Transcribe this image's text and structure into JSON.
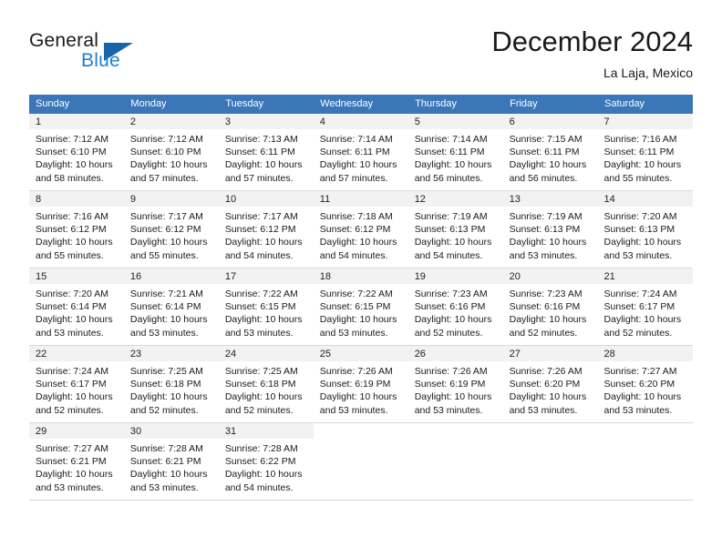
{
  "brand": {
    "name_part1": "General",
    "name_part2": "Blue",
    "triangle_color": "#1565a8",
    "blue_color": "#1f7fd0"
  },
  "header": {
    "title": "December 2024",
    "location": "La Laja, Mexico"
  },
  "theme": {
    "header_row_color": "#3A76B8",
    "daynum_band_color": "#f2f2f2",
    "grid_line_color": "#d9d9d9"
  },
  "weekdays": [
    "Sunday",
    "Monday",
    "Tuesday",
    "Wednesday",
    "Thursday",
    "Friday",
    "Saturday"
  ],
  "weeks": [
    [
      {
        "day": "1",
        "sunrise": "Sunrise: 7:12 AM",
        "sunset": "Sunset: 6:10 PM",
        "daylight_line1": "Daylight: 10 hours",
        "daylight_line2": "and 58 minutes."
      },
      {
        "day": "2",
        "sunrise": "Sunrise: 7:12 AM",
        "sunset": "Sunset: 6:10 PM",
        "daylight_line1": "Daylight: 10 hours",
        "daylight_line2": "and 57 minutes."
      },
      {
        "day": "3",
        "sunrise": "Sunrise: 7:13 AM",
        "sunset": "Sunset: 6:11 PM",
        "daylight_line1": "Daylight: 10 hours",
        "daylight_line2": "and 57 minutes."
      },
      {
        "day": "4",
        "sunrise": "Sunrise: 7:14 AM",
        "sunset": "Sunset: 6:11 PM",
        "daylight_line1": "Daylight: 10 hours",
        "daylight_line2": "and 57 minutes."
      },
      {
        "day": "5",
        "sunrise": "Sunrise: 7:14 AM",
        "sunset": "Sunset: 6:11 PM",
        "daylight_line1": "Daylight: 10 hours",
        "daylight_line2": "and 56 minutes."
      },
      {
        "day": "6",
        "sunrise": "Sunrise: 7:15 AM",
        "sunset": "Sunset: 6:11 PM",
        "daylight_line1": "Daylight: 10 hours",
        "daylight_line2": "and 56 minutes."
      },
      {
        "day": "7",
        "sunrise": "Sunrise: 7:16 AM",
        "sunset": "Sunset: 6:11 PM",
        "daylight_line1": "Daylight: 10 hours",
        "daylight_line2": "and 55 minutes."
      }
    ],
    [
      {
        "day": "8",
        "sunrise": "Sunrise: 7:16 AM",
        "sunset": "Sunset: 6:12 PM",
        "daylight_line1": "Daylight: 10 hours",
        "daylight_line2": "and 55 minutes."
      },
      {
        "day": "9",
        "sunrise": "Sunrise: 7:17 AM",
        "sunset": "Sunset: 6:12 PM",
        "daylight_line1": "Daylight: 10 hours",
        "daylight_line2": "and 55 minutes."
      },
      {
        "day": "10",
        "sunrise": "Sunrise: 7:17 AM",
        "sunset": "Sunset: 6:12 PM",
        "daylight_line1": "Daylight: 10 hours",
        "daylight_line2": "and 54 minutes."
      },
      {
        "day": "11",
        "sunrise": "Sunrise: 7:18 AM",
        "sunset": "Sunset: 6:12 PM",
        "daylight_line1": "Daylight: 10 hours",
        "daylight_line2": "and 54 minutes."
      },
      {
        "day": "12",
        "sunrise": "Sunrise: 7:19 AM",
        "sunset": "Sunset: 6:13 PM",
        "daylight_line1": "Daylight: 10 hours",
        "daylight_line2": "and 54 minutes."
      },
      {
        "day": "13",
        "sunrise": "Sunrise: 7:19 AM",
        "sunset": "Sunset: 6:13 PM",
        "daylight_line1": "Daylight: 10 hours",
        "daylight_line2": "and 53 minutes."
      },
      {
        "day": "14",
        "sunrise": "Sunrise: 7:20 AM",
        "sunset": "Sunset: 6:13 PM",
        "daylight_line1": "Daylight: 10 hours",
        "daylight_line2": "and 53 minutes."
      }
    ],
    [
      {
        "day": "15",
        "sunrise": "Sunrise: 7:20 AM",
        "sunset": "Sunset: 6:14 PM",
        "daylight_line1": "Daylight: 10 hours",
        "daylight_line2": "and 53 minutes."
      },
      {
        "day": "16",
        "sunrise": "Sunrise: 7:21 AM",
        "sunset": "Sunset: 6:14 PM",
        "daylight_line1": "Daylight: 10 hours",
        "daylight_line2": "and 53 minutes."
      },
      {
        "day": "17",
        "sunrise": "Sunrise: 7:22 AM",
        "sunset": "Sunset: 6:15 PM",
        "daylight_line1": "Daylight: 10 hours",
        "daylight_line2": "and 53 minutes."
      },
      {
        "day": "18",
        "sunrise": "Sunrise: 7:22 AM",
        "sunset": "Sunset: 6:15 PM",
        "daylight_line1": "Daylight: 10 hours",
        "daylight_line2": "and 53 minutes."
      },
      {
        "day": "19",
        "sunrise": "Sunrise: 7:23 AM",
        "sunset": "Sunset: 6:16 PM",
        "daylight_line1": "Daylight: 10 hours",
        "daylight_line2": "and 52 minutes."
      },
      {
        "day": "20",
        "sunrise": "Sunrise: 7:23 AM",
        "sunset": "Sunset: 6:16 PM",
        "daylight_line1": "Daylight: 10 hours",
        "daylight_line2": "and 52 minutes."
      },
      {
        "day": "21",
        "sunrise": "Sunrise: 7:24 AM",
        "sunset": "Sunset: 6:17 PM",
        "daylight_line1": "Daylight: 10 hours",
        "daylight_line2": "and 52 minutes."
      }
    ],
    [
      {
        "day": "22",
        "sunrise": "Sunrise: 7:24 AM",
        "sunset": "Sunset: 6:17 PM",
        "daylight_line1": "Daylight: 10 hours",
        "daylight_line2": "and 52 minutes."
      },
      {
        "day": "23",
        "sunrise": "Sunrise: 7:25 AM",
        "sunset": "Sunset: 6:18 PM",
        "daylight_line1": "Daylight: 10 hours",
        "daylight_line2": "and 52 minutes."
      },
      {
        "day": "24",
        "sunrise": "Sunrise: 7:25 AM",
        "sunset": "Sunset: 6:18 PM",
        "daylight_line1": "Daylight: 10 hours",
        "daylight_line2": "and 52 minutes."
      },
      {
        "day": "25",
        "sunrise": "Sunrise: 7:26 AM",
        "sunset": "Sunset: 6:19 PM",
        "daylight_line1": "Daylight: 10 hours",
        "daylight_line2": "and 53 minutes."
      },
      {
        "day": "26",
        "sunrise": "Sunrise: 7:26 AM",
        "sunset": "Sunset: 6:19 PM",
        "daylight_line1": "Daylight: 10 hours",
        "daylight_line2": "and 53 minutes."
      },
      {
        "day": "27",
        "sunrise": "Sunrise: 7:26 AM",
        "sunset": "Sunset: 6:20 PM",
        "daylight_line1": "Daylight: 10 hours",
        "daylight_line2": "and 53 minutes."
      },
      {
        "day": "28",
        "sunrise": "Sunrise: 7:27 AM",
        "sunset": "Sunset: 6:20 PM",
        "daylight_line1": "Daylight: 10 hours",
        "daylight_line2": "and 53 minutes."
      }
    ],
    [
      {
        "day": "29",
        "sunrise": "Sunrise: 7:27 AM",
        "sunset": "Sunset: 6:21 PM",
        "daylight_line1": "Daylight: 10 hours",
        "daylight_line2": "and 53 minutes."
      },
      {
        "day": "30",
        "sunrise": "Sunrise: 7:28 AM",
        "sunset": "Sunset: 6:21 PM",
        "daylight_line1": "Daylight: 10 hours",
        "daylight_line2": "and 53 minutes."
      },
      {
        "day": "31",
        "sunrise": "Sunrise: 7:28 AM",
        "sunset": "Sunset: 6:22 PM",
        "daylight_line1": "Daylight: 10 hours",
        "daylight_line2": "and 54 minutes."
      },
      {
        "day": "",
        "sunrise": "",
        "sunset": "",
        "daylight_line1": "",
        "daylight_line2": ""
      },
      {
        "day": "",
        "sunrise": "",
        "sunset": "",
        "daylight_line1": "",
        "daylight_line2": ""
      },
      {
        "day": "",
        "sunrise": "",
        "sunset": "",
        "daylight_line1": "",
        "daylight_line2": ""
      },
      {
        "day": "",
        "sunrise": "",
        "sunset": "",
        "daylight_line1": "",
        "daylight_line2": ""
      }
    ]
  ]
}
